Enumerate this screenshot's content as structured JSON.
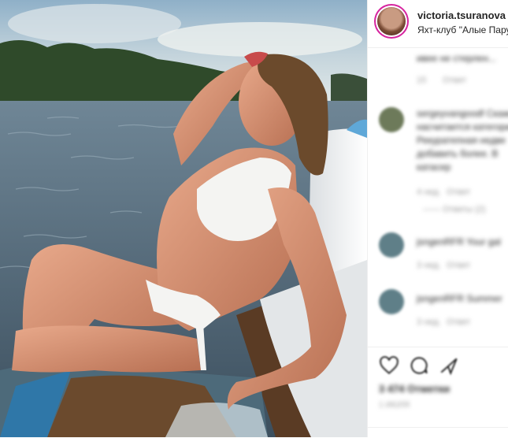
{
  "post": {
    "username": "victoria.tsuranova",
    "location": "Яхт-клуб \"Алые Паруса\""
  },
  "comments": [
    {
      "user": "",
      "text": "ивее не стерлен...",
      "meta": "15",
      "reply": "Ответ"
    },
    {
      "user": "sergeyvangoodf",
      "text_lines": [
        "sergeyvangoodf Скажите",
        "насчитается категории",
        "Рекуратепная недве",
        "добавить более. В",
        "катасер"
      ],
      "meta": "4 нед.",
      "reply": "Ответ",
      "replies": "—— Ответы (2)"
    },
    {
      "user": "jsngenRFR",
      "text": "jsngenRFR Your gal",
      "meta": "3 нед.",
      "reply": "Ответ"
    },
    {
      "user": "jsngenRFR",
      "text": "jsngenRFR Summer",
      "meta": "3 нед.",
      "reply": "Ответ"
    }
  ],
  "actions": {
    "likes": "3 474 Отметки",
    "date": "1 ИЮЛЯ"
  },
  "icons": [
    "heart-icon",
    "comment-icon",
    "share-icon"
  ],
  "colors": {
    "story_ring": "#d6249f",
    "text": "#262626",
    "muted": "#999999",
    "divider": "#efefef"
  }
}
